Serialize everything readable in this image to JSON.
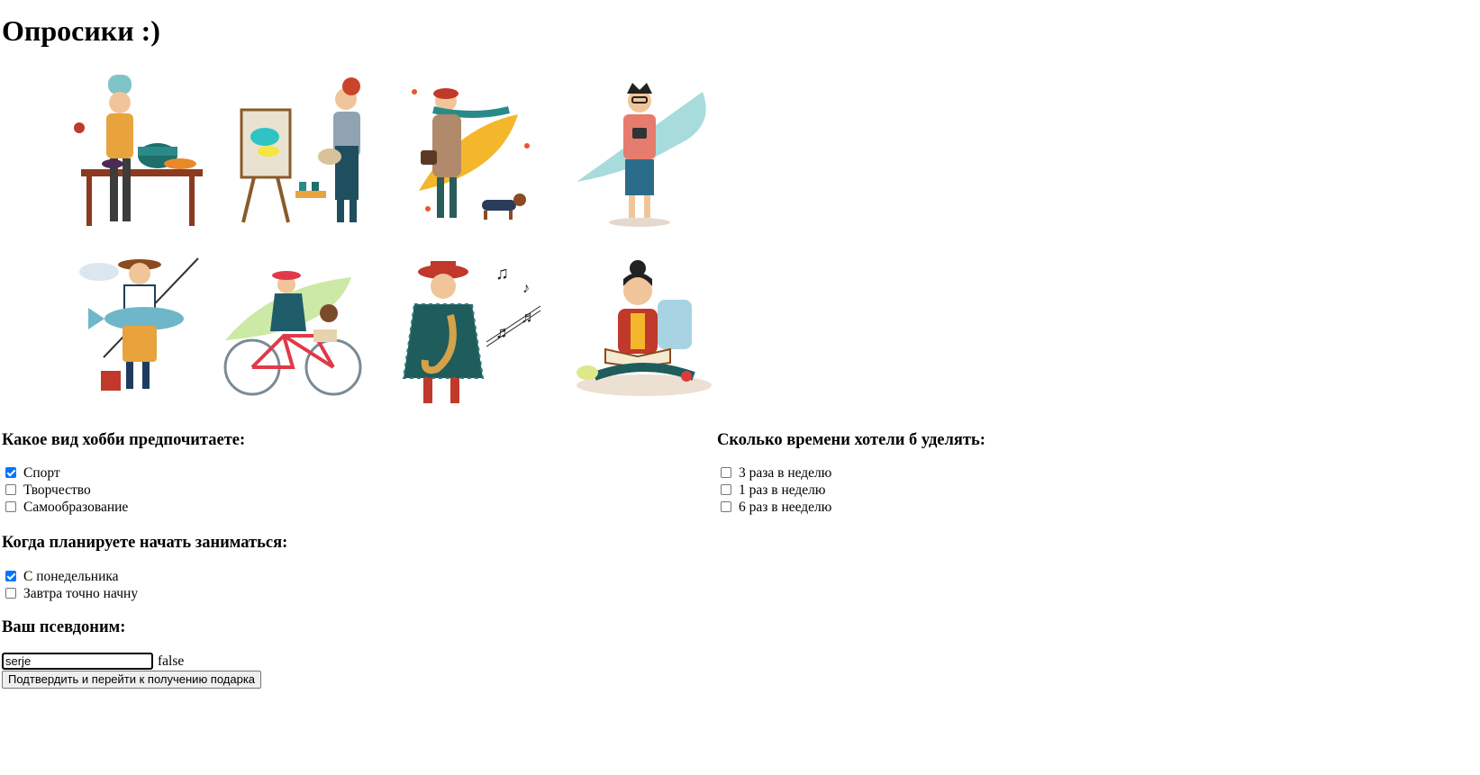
{
  "page": {
    "title": "Опросики :)"
  },
  "gallery": {
    "illustrations": [
      {
        "icon": "chef-cooking-icon"
      },
      {
        "icon": "painter-easel-icon"
      },
      {
        "icon": "autumn-walk-dog-icon"
      },
      {
        "icon": "photographer-icon"
      },
      {
        "icon": "fisherman-icon"
      },
      {
        "icon": "cyclist-icon"
      },
      {
        "icon": "saxophonist-icon"
      },
      {
        "icon": "reading-girl-icon"
      }
    ]
  },
  "survey": {
    "hobby": {
      "heading": "Какое вид хобби предпочитаете:",
      "options": [
        {
          "label": "Спорт",
          "checked": true
        },
        {
          "label": "Творчество",
          "checked": false
        },
        {
          "label": "Самообразование",
          "checked": false
        }
      ]
    },
    "time": {
      "heading": "Сколько времени хотели б уделять:",
      "options": [
        {
          "label": "3 раза в неделю",
          "checked": false
        },
        {
          "label": "1 раз в неделю",
          "checked": false
        },
        {
          "label": "6 раз в нееделю",
          "checked": false
        }
      ]
    },
    "start": {
      "heading": "Когда планируете начать заниматься:",
      "options": [
        {
          "label": "С понедельника",
          "checked": true
        },
        {
          "label": "Завтра точно начну",
          "checked": false
        }
      ]
    },
    "nickname": {
      "heading": "Ваш псевдоним:",
      "value": "serje",
      "flag": "false"
    },
    "submit_label": "Подтвердить и перейти к получению подарка"
  },
  "colors": {
    "checkbox_accent": "#0075ff",
    "illustration_palette": [
      "#e8a33d",
      "#2a8a8a",
      "#c0392b",
      "#f4c542",
      "#1f4e5f",
      "#a8dcdc"
    ]
  }
}
